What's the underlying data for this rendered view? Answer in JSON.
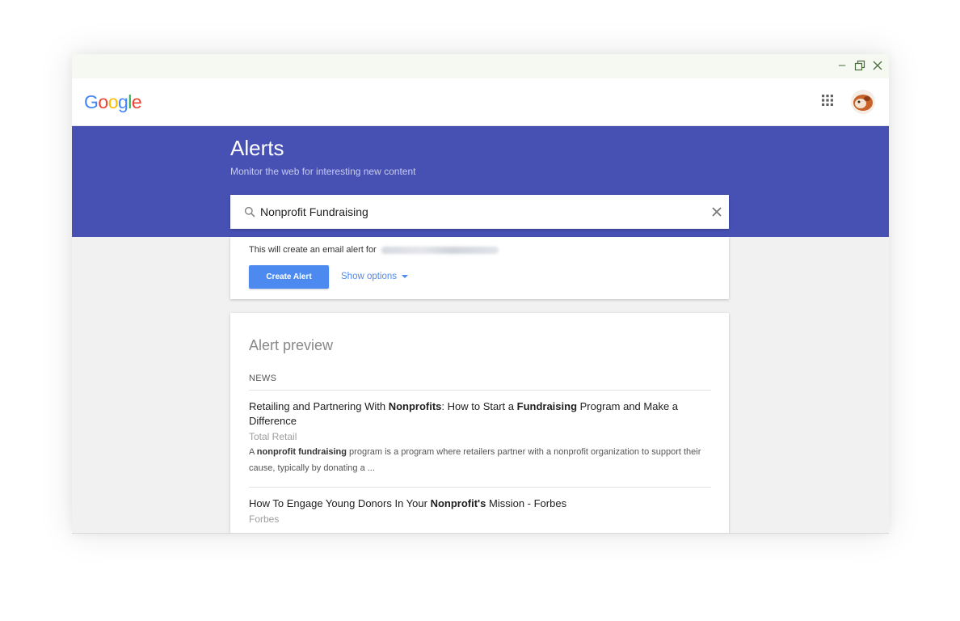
{
  "window": {
    "controls": [
      {
        "name": "minimize-icon",
        "glyph": "—"
      },
      {
        "name": "restore-icon",
        "glyph": "restore"
      },
      {
        "name": "close-icon",
        "glyph": "×"
      }
    ]
  },
  "header": {
    "logo_letters": [
      {
        "ch": "G",
        "color": "#4285f4"
      },
      {
        "ch": "o",
        "color": "#ea4335"
      },
      {
        "ch": "o",
        "color": "#fbbc05"
      },
      {
        "ch": "g",
        "color": "#4285f4"
      },
      {
        "ch": "l",
        "color": "#34a853"
      },
      {
        "ch": "e",
        "color": "#ea4335"
      }
    ],
    "apps_icon": "grid-icon",
    "avatar_icon": "avatar-icon"
  },
  "hero": {
    "title": "Alerts",
    "subtitle": "Monitor the web for interesting new content",
    "background": "#4751b4"
  },
  "search": {
    "value": "Nonprofit Fundraising",
    "search_icon": "search-icon",
    "clear_icon": "close-icon"
  },
  "create": {
    "notice": "This will create an email alert for",
    "button_label": "Create Alert",
    "options_label": "Show options",
    "accent": "#4d8af0"
  },
  "preview": {
    "title": "Alert preview",
    "section_label": "NEWS",
    "results": [
      {
        "title_parts": [
          {
            "t": "Retailing and Partnering With ",
            "b": false
          },
          {
            "t": "Nonprofits",
            "b": true
          },
          {
            "t": ": How to Start a ",
            "b": false
          },
          {
            "t": "Fundraising",
            "b": true
          },
          {
            "t": " Program and Make a Difference",
            "b": false
          }
        ],
        "source": "Total Retail",
        "snippet_parts": [
          {
            "t": "A ",
            "b": false
          },
          {
            "t": "nonprofit fundraising",
            "b": true
          },
          {
            "t": " program is a program where retailers partner with a nonprofit organization to support their cause, typically by donating a ...",
            "b": false
          }
        ]
      },
      {
        "title_parts": [
          {
            "t": "How To Engage Young Donors In Your ",
            "b": false
          },
          {
            "t": "Nonprofit's",
            "b": true
          },
          {
            "t": " Mission - Forbes",
            "b": false
          }
        ],
        "source": "Forbes",
        "snippet_parts": []
      }
    ]
  }
}
